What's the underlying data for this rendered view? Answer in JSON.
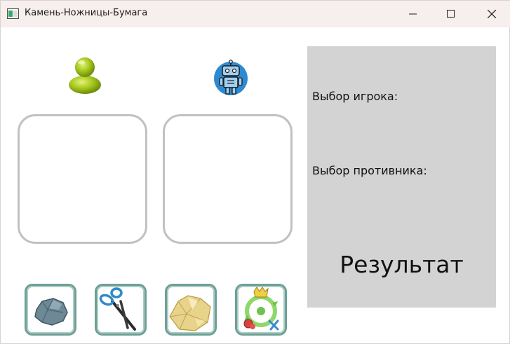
{
  "window": {
    "title": "Камень-Ножницы-Бумага"
  },
  "icons": {
    "player": "user-icon",
    "opponent": "robot-icon",
    "minimize": "minimize-icon",
    "maximize": "maximize-icon",
    "close": "close-icon"
  },
  "panel": {
    "player_choice_label": "Выбор игрока:",
    "opponent_choice_label": "Выбор противника:",
    "result_label": "Результат"
  },
  "choices": [
    {
      "name": "rock",
      "icon": "rock-icon"
    },
    {
      "name": "scissors",
      "icon": "scissors-icon"
    },
    {
      "name": "paper",
      "icon": "paper-icon"
    },
    {
      "name": "random",
      "icon": "random-icon"
    }
  ],
  "colors": {
    "titlebar": "#f7eeee",
    "panel": "#d3d3d3",
    "slot_border": "#c1c1c1",
    "choice_border": "#6f9f95",
    "player_icon": "#9bc41a",
    "robot_icon": "#2e8ad0"
  }
}
